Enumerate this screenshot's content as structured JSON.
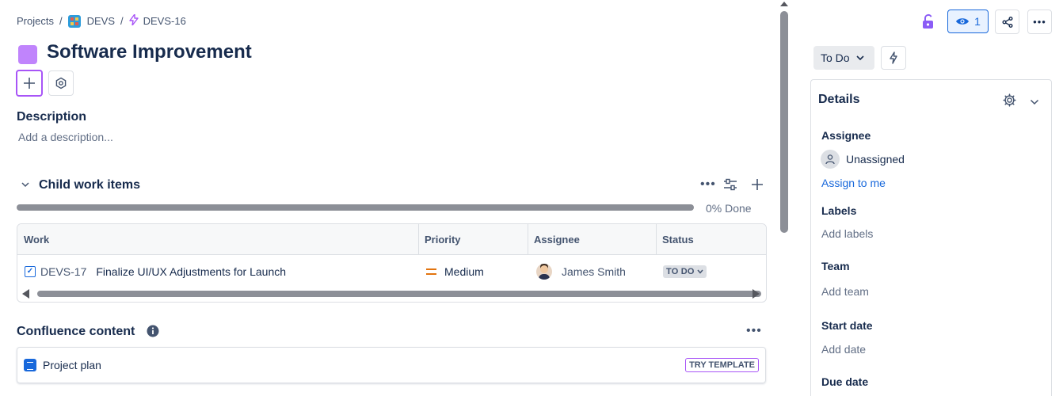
{
  "breadcrumb": {
    "projects": "Projects",
    "project": "DEVS",
    "issue": "DEVS-16"
  },
  "issue": {
    "title": "Software Improvement",
    "epic_color": "#c084fc"
  },
  "description": {
    "heading": "Description",
    "placeholder": "Add a description..."
  },
  "child_items": {
    "heading": "Child work items",
    "progress_text": "0% Done",
    "progress": 0,
    "columns": [
      "Work",
      "Priority",
      "Assignee",
      "Status"
    ],
    "rows": [
      {
        "key": "DEVS-17",
        "summary": "Finalize UI/UX Adjustments for Launch",
        "priority": "Medium",
        "assignee": "James Smith",
        "status": "TO DO"
      }
    ]
  },
  "confluence": {
    "heading": "Confluence content",
    "items": [
      {
        "title": "Project plan",
        "action": "TRY TEMPLATE"
      }
    ]
  },
  "header_actions": {
    "watch_count": "1"
  },
  "status_button": {
    "label": "To Do"
  },
  "details": {
    "heading": "Details",
    "assignee_label": "Assignee",
    "assignee_value": "Unassigned",
    "assign_to_me": "Assign to me",
    "labels_label": "Labels",
    "labels_value": "Add labels",
    "team_label": "Team",
    "team_value": "Add team",
    "start_date_label": "Start date",
    "start_date_value": "Add date",
    "due_date_label": "Due date"
  },
  "colors": {
    "accent": "#1868db",
    "purple": "#a855f7",
    "priority_medium": "#e2740f"
  }
}
